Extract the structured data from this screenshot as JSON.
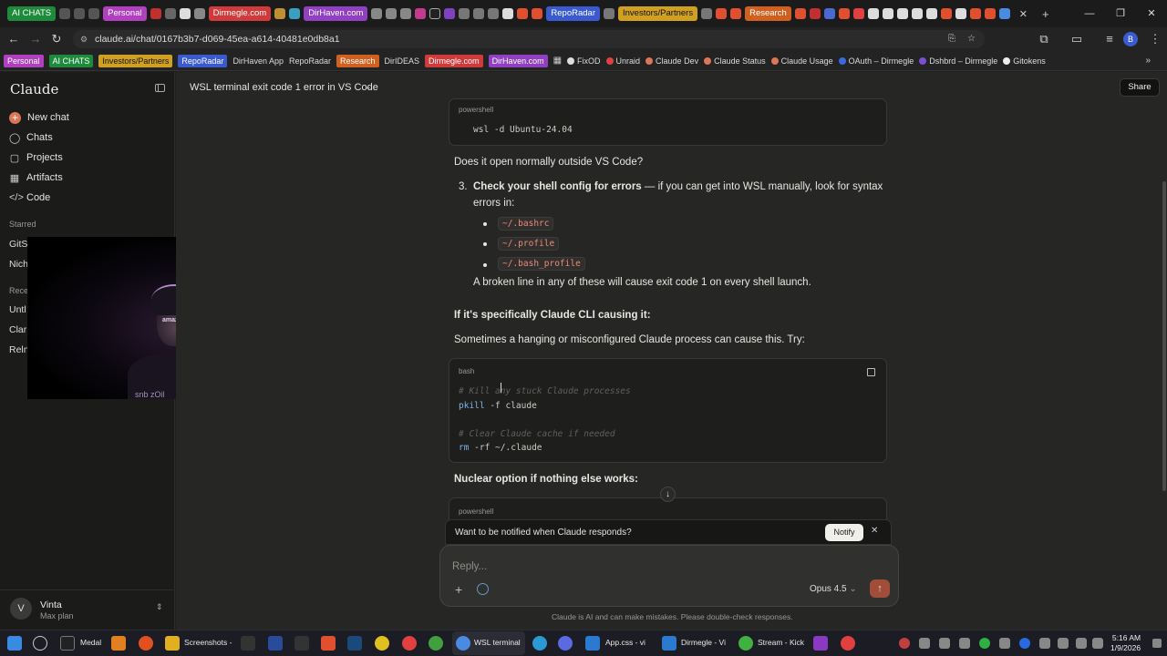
{
  "browser": {
    "tabs": [
      "AI CHATS",
      "Personal",
      "Dirmegle.com",
      "DirHaven.com",
      "RepoRadar",
      "Investors/Partners",
      "Research"
    ],
    "url": "claude.ai/chat/0167b3b7-d069-45ea-a614-40481e0db8a1",
    "profile_initial": "B",
    "bookmarks_chips": [
      "Personal",
      "AI CHATS",
      "Investors/Partners",
      "RepoRadar"
    ],
    "bookmarks_text": [
      "DirHaven App",
      "RepoRadar",
      "Research",
      "DirIDEAS",
      "Dirmegle.com",
      "DirHaven.com",
      "FixOD",
      "Unraid",
      "Claude Dev",
      "Claude Status",
      "Claude Usage",
      "OAuth – Dirmegle",
      "Dshbrd – Dirmegle",
      "Gitokens"
    ]
  },
  "sidebar": {
    "logo": "Claude",
    "new_chat": "New chat",
    "nav": [
      "Chats",
      "Projects",
      "Artifacts",
      "Code"
    ],
    "starred_label": "Starred",
    "starred": [
      "GitS",
      "Nich"
    ],
    "recents_label": "Rece",
    "recents": [
      "Untl",
      "Clar",
      "Reln"
    ],
    "user": {
      "initial": "V",
      "name": "Vinta",
      "plan": "Max plan"
    }
  },
  "webcam": {
    "cap_text": "amazon",
    "shirt_text": "snb zOil"
  },
  "header": {
    "title": "WSL terminal exit code 1 error in VS Code",
    "share": "Share"
  },
  "chat": {
    "code1_lang": "powershell",
    "code1_line": "wsl -d Ubuntu-24.04",
    "q_outside": "Does it open normally outside VS Code?",
    "step3_num": "3.",
    "step3_bold": "Check your shell config for errors",
    "step3_rest": " — if you can get into WSL manually, look for syntax",
    "step3_rest2": "errors in:",
    "files": [
      "~/.bashrc",
      "~/.profile",
      "~/.bash_profile"
    ],
    "broken_line": "A broken line in any of these will cause exit code 1 on every shell launch.",
    "h_cli": "If it's specifically Claude CLI causing it:",
    "p_hanging": "Sometimes a hanging or misconfigured Claude process can cause this. Try:",
    "code2_lang": "bash",
    "code2_comment1": "# Kill any stuck Claude processes",
    "code2_cmd1_kw": "pkill",
    "code2_cmd1_rest": " -f claude",
    "code2_comment2": "# Clear Claude cache if needed",
    "code2_cmd2_kw": "rm",
    "code2_cmd2_rest": " -rf ~/.claude",
    "h_nuclear": "Nuclear option if nothing else works:",
    "code3_lang": "powershell"
  },
  "notify": {
    "text": "Want to be notified when Claude responds?",
    "button": "Notify"
  },
  "reply": {
    "placeholder": "Reply...",
    "model": "Opus 4.5"
  },
  "disclaimer": "Claude is AI and can make mistakes. Please double-check responses.",
  "taskbar": {
    "items": [
      "Medal",
      "Screenshots -",
      "WSL terminal",
      "App.css - vi",
      "Dirmegle - Vi",
      "Stream - Kick"
    ],
    "time": "5:16 AM",
    "date": "1/9/2026"
  },
  "colors": {
    "accent": "#d97757",
    "send": "#a04e39",
    "inline_code": "#ec8a7a"
  }
}
